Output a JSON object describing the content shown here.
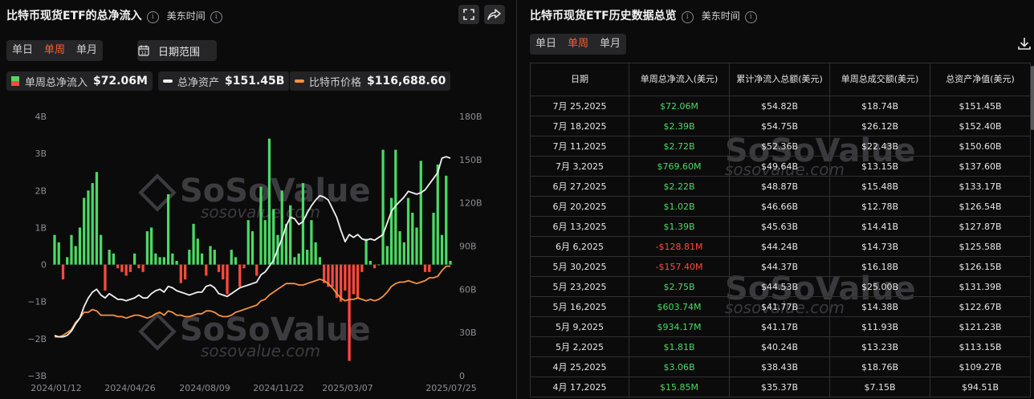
{
  "left": {
    "title": "比特币现货ETF的总净流入",
    "timezone": "美东时间",
    "period_tabs": [
      "单日",
      "单周",
      "单月"
    ],
    "active_period": "单周",
    "date_range_label": "日期范围",
    "legend": [
      {
        "label": "单周总净流入",
        "value": "$72.06M"
      },
      {
        "label": "总净资产",
        "value": "$151.45B"
      },
      {
        "label": "比特币价格",
        "value": "$116,688.60"
      }
    ],
    "watermark": {
      "brand": "SoSoValue",
      "url": "sosovalue.com"
    }
  },
  "right": {
    "title": "比特币现货ETF历史数据总览",
    "timezone": "美东时间",
    "period_tabs": [
      "单日",
      "单周",
      "单月"
    ],
    "active_period": "单周",
    "columns": [
      "日期",
      "单周总净流入(美元)",
      "累计净流入总额(美元)",
      "单周总成交额(美元)",
      "总资产净值(美元)"
    ],
    "rows": [
      [
        "7月 25,2025",
        "$72.06M",
        "$54.82B",
        "$18.74B",
        "$151.45B"
      ],
      [
        "7月 18,2025",
        "$2.39B",
        "$54.75B",
        "$26.12B",
        "$152.40B"
      ],
      [
        "7月 11,2025",
        "$2.72B",
        "$52.36B",
        "$22.43B",
        "$150.60B"
      ],
      [
        "7月 3,2025",
        "$769.60M",
        "$49.64B",
        "$13.15B",
        "$137.60B"
      ],
      [
        "6月 27,2025",
        "$2.22B",
        "$48.87B",
        "$15.48B",
        "$133.17B"
      ],
      [
        "6月 20,2025",
        "$1.02B",
        "$46.66B",
        "$12.78B",
        "$126.54B"
      ],
      [
        "6月 13,2025",
        "$1.39B",
        "$45.63B",
        "$14.41B",
        "$127.87B"
      ],
      [
        "6月 6,2025",
        "-$128.81M",
        "$44.24B",
        "$14.73B",
        "$125.58B"
      ],
      [
        "5月 30,2025",
        "-$157.40M",
        "$44.37B",
        "$16.18B",
        "$126.15B"
      ],
      [
        "5月 23,2025",
        "$2.75B",
        "$44.53B",
        "$25.00B",
        "$131.39B"
      ],
      [
        "5月 16,2025",
        "$603.74M",
        "$41.77B",
        "$14.38B",
        "$122.67B"
      ],
      [
        "5月 9,2025",
        "$934.17M",
        "$41.17B",
        "$11.93B",
        "$121.23B"
      ],
      [
        "5月 2,2025",
        "$1.81B",
        "$40.24B",
        "$13.23B",
        "$113.15B"
      ],
      [
        "4月 25,2025",
        "$3.06B",
        "$38.43B",
        "$18.76B",
        "$109.27B"
      ],
      [
        "4月 17,2025",
        "$15.85M",
        "$35.37B",
        "$7.15B",
        "$94.51B"
      ]
    ],
    "watermark": {
      "brand": "SoSoValue",
      "url": "sosovalue.com"
    }
  },
  "colors": {
    "positive": "#4cd964",
    "negative": "#ff4a3d",
    "active_tab": "#ff5c2e",
    "net_assets_line": "#f2f2f2",
    "btc_price_line": "#f5923e"
  },
  "chart_data": {
    "type": "bar",
    "x_tick_labels": [
      "2024/01/12",
      "2024/04/26",
      "2024/08/09",
      "2024/11/22",
      "2025/03/07",
      "2025/07/25"
    ],
    "y_left_ticks": [
      "4B",
      "3B",
      "2B",
      "1B",
      "0",
      "−1B",
      "−2B",
      "−3B"
    ],
    "y_left_range": [
      -3,
      4
    ],
    "y_right_ticks": [
      "180B",
      "150B",
      "120B",
      "90B",
      "60B",
      "30B",
      "0"
    ],
    "y_right_range": [
      0,
      180
    ],
    "series": [
      {
        "name": "单周总净流入",
        "type": "bar",
        "unit": "B USD",
        "values": [
          0.8,
          0.6,
          -0.4,
          0.2,
          0.8,
          0.5,
          1.0,
          1.8,
          2.0,
          2.2,
          2.5,
          0.8,
          -0.7,
          0.4,
          0.3,
          -0.1,
          -0.2,
          -0.3,
          -0.2,
          0.3,
          -0.1,
          -0.2,
          0.9,
          1.0,
          0.3,
          0.2,
          0.2,
          1.9,
          0.3,
          0.1,
          -0.5,
          -0.4,
          0.4,
          1.1,
          0.7,
          0.3,
          -0.3,
          0.5,
          0.4,
          -0.2,
          -0.4,
          -0.8,
          0.4,
          0.2,
          -0.6,
          -0.1,
          1.2,
          0.9,
          -0.3,
          2.1,
          1.2,
          3.4,
          1.5,
          0.8,
          2.0,
          1.1,
          1.6,
          0.2,
          0.3,
          2.2,
          0.4,
          1.2,
          0.6,
          0.2,
          -0.5,
          -0.6,
          -0.6,
          -0.9,
          -1.0,
          -0.7,
          -2.6,
          -0.8,
          -0.9,
          -0.2,
          0.7,
          0.1,
          -0.1,
          0.0,
          3.1,
          0.5,
          1.8,
          3.1,
          0.9,
          0.6,
          1.8,
          1.4,
          1.0,
          2.8,
          -0.2,
          -0.2,
          1.4,
          2.7,
          0.8,
          2.4,
          0.1
        ]
      },
      {
        "name": "总净资产",
        "type": "line",
        "unit": "B USD",
        "values": [
          28,
          27,
          27,
          28,
          31,
          36,
          40,
          48,
          54,
          58,
          60,
          56,
          54,
          57,
          55,
          53,
          53,
          52,
          53,
          54,
          56,
          54,
          54,
          57,
          59,
          60,
          58,
          62,
          61,
          59,
          58,
          57,
          56,
          57,
          58,
          58,
          62,
          63,
          61,
          57,
          56,
          55,
          57,
          59,
          61,
          62,
          63,
          64,
          65,
          70,
          72,
          76,
          80,
          88,
          95,
          104,
          110,
          109,
          105,
          107,
          113,
          118,
          122,
          125,
          124,
          122,
          116,
          110,
          101,
          93,
          98,
          96,
          98,
          95,
          94,
          95,
          94,
          96,
          98,
          106,
          114,
          118,
          121,
          124,
          128,
          127,
          126,
          127,
          129,
          133,
          137,
          141,
          151,
          152,
          151
        ]
      },
      {
        "name": "比特币价格",
        "type": "line",
        "unit": "B-axis scale",
        "values": [
          27,
          27,
          28,
          30,
          32,
          37,
          40,
          44,
          44,
          46,
          45,
          42,
          42,
          42,
          42,
          41,
          41,
          40,
          41,
          42,
          42,
          41,
          40,
          41,
          43,
          44,
          42,
          45,
          44,
          42,
          42,
          41,
          41,
          42,
          43,
          43,
          45,
          45,
          44,
          42,
          41,
          41,
          42,
          44,
          45,
          46,
          47,
          48,
          49,
          52,
          53,
          56,
          58,
          60,
          62,
          64,
          64,
          64,
          63,
          63,
          64,
          65,
          66,
          67,
          66,
          64,
          61,
          57,
          54,
          52,
          53,
          53,
          54,
          53,
          52,
          53,
          52,
          53,
          55,
          58,
          62,
          64,
          65,
          65,
          66,
          65,
          64,
          65,
          66,
          68,
          68,
          69,
          73,
          76,
          76
        ]
      }
    ]
  }
}
